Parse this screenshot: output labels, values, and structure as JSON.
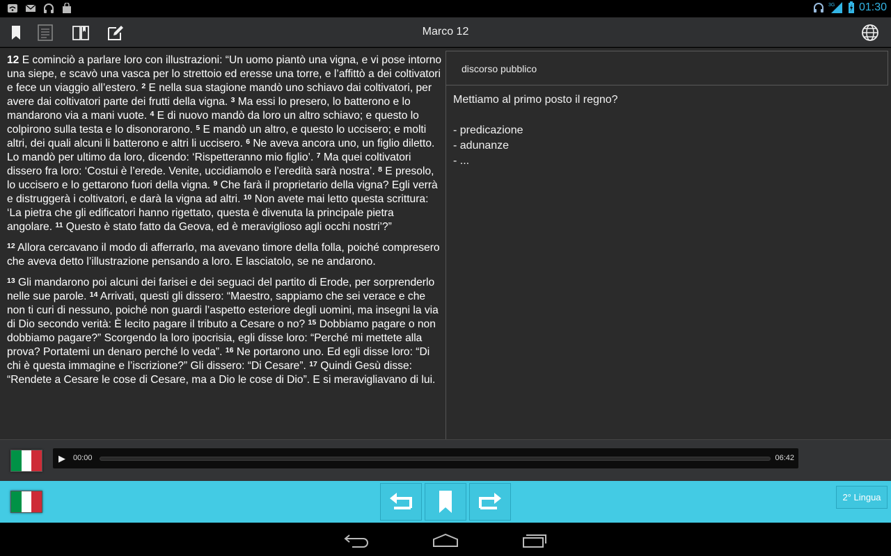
{
  "status_bar": {
    "time": "01:30",
    "left_icons": [
      "wifi-icon",
      "mail-icon",
      "headphones-icon",
      "shopping-bag-icon"
    ],
    "right_icons": [
      "headphones-icon",
      "signal-3g-icon",
      "battery-charging-icon"
    ],
    "network_label": "3G"
  },
  "action_bar": {
    "title": "Marco 12",
    "left_icons": [
      "bookmark-icon",
      "list-icon",
      "book-icon",
      "edit-note-icon"
    ],
    "right_icon": "globe-icon"
  },
  "bible": {
    "paragraphs": [
      [
        {
          "t": "chap",
          "v": "12"
        },
        {
          "t": "txt",
          "v": " E cominciò a parlare loro con illustrazioni: “Un uomo piantò una vigna, e vi pose intorno una siepe, e scavò una vasca per lo strettoio ed eresse una torre, e l’affittò a dei coltivatori e fece un viaggio all’estero. "
        },
        {
          "t": "sup",
          "v": "2"
        },
        {
          "t": "txt",
          "v": " E nella sua stagione mandò uno schiavo dai coltivatori, per avere dai coltivatori parte dei frutti della vigna. "
        },
        {
          "t": "sup",
          "v": "3"
        },
        {
          "t": "txt",
          "v": " Ma essi lo presero, lo batterono e lo mandarono via a mani vuote. "
        },
        {
          "t": "sup",
          "v": "4"
        },
        {
          "t": "txt",
          "v": " E di nuovo mandò da loro un altro schiavo; e questo lo colpirono sulla testa e lo disonorarono. "
        },
        {
          "t": "sup",
          "v": "5"
        },
        {
          "t": "txt",
          "v": " E mandò un altro, e questo lo uccisero; e molti altri, dei quali alcuni li batterono e altri li uccisero. "
        },
        {
          "t": "sup",
          "v": "6"
        },
        {
          "t": "txt",
          "v": " Ne aveva ancora uno, un figlio diletto. Lo mandò per ultimo da loro, dicendo: ‘Rispetteranno mio figlio’. "
        },
        {
          "t": "sup",
          "v": "7"
        },
        {
          "t": "txt",
          "v": " Ma quei coltivatori dissero fra loro: ‘Costui è l’erede. Venite, uccidiamolo e l’eredità sarà nostra’. "
        },
        {
          "t": "sup",
          "v": "8"
        },
        {
          "t": "txt",
          "v": " E presolo, lo uccisero e lo gettarono fuori della vigna. "
        },
        {
          "t": "sup",
          "v": "9"
        },
        {
          "t": "txt",
          "v": " Che farà il proprietario della vigna? Egli verrà e distruggerà i coltivatori, e darà la vigna ad altri. "
        },
        {
          "t": "sup",
          "v": "10"
        },
        {
          "t": "txt",
          "v": " Non avete mai letto questa scrittura: ‘La pietra che gli edificatori hanno rigettato, questa è divenuta la principale pietra angolare. "
        },
        {
          "t": "sup",
          "v": "11"
        },
        {
          "t": "txt",
          "v": " Questo è stato fatto da Geova, ed è meraviglioso agli occhi nostri’?”"
        }
      ],
      [
        {
          "t": "sup",
          "v": "12"
        },
        {
          "t": "txt",
          "v": " Allora cercavano il modo di afferrarlo, ma avevano timore della folla, poiché compresero che aveva detto l’illustrazione pensando a loro. E lasciatolo, se ne andarono."
        }
      ],
      [
        {
          "t": "sup",
          "v": "13"
        },
        {
          "t": "txt",
          "v": " Gli mandarono poi alcuni dei farisei e dei seguaci del partito di Erode, per sorprenderlo nelle sue parole. "
        },
        {
          "t": "sup",
          "v": "14"
        },
        {
          "t": "txt",
          "v": " Arrivati, questi gli dissero: “Maestro, sappiamo che sei verace e che non ti curi di nessuno, poiché non guardi l’aspetto esteriore degli uomini, ma insegni la via di Dio secondo verità: È lecito pagare il tributo a Cesare o no? "
        },
        {
          "t": "sup",
          "v": "15"
        },
        {
          "t": "txt",
          "v": " Dobbiamo pagare o non dobbiamo pagare?” Scorgendo la loro ipocrisia, egli disse loro: “Perché mi mettete alla prova? Portatemi un denaro perché lo veda”. "
        },
        {
          "t": "sup",
          "v": "16"
        },
        {
          "t": "txt",
          "v": " Ne portarono uno. Ed egli disse loro: “Di chi è questa immagine e l’iscrizione?” Gli dissero: “Di Cesare”. "
        },
        {
          "t": "sup",
          "v": "17"
        },
        {
          "t": "txt",
          "v": " Quindi Gesù disse: “Rendete a Cesare le cose di Cesare, ma a Dio le cose di Dio”. E si meravigliavano di lui."
        }
      ]
    ]
  },
  "notes": {
    "title": "discorso pubblico",
    "lines": [
      "Mettiamo al primo posto il regno?",
      "",
      "- predicazione",
      "- adunanze",
      "- ..."
    ]
  },
  "audio": {
    "current_time": "00:00",
    "total_time": "06:42",
    "progress": 0,
    "play_symbol": "▶"
  },
  "lang_bar": {
    "second_language_label": "2° Lingua",
    "buttons": [
      "back-arrow-icon",
      "bookmark-icon",
      "forward-arrow-icon"
    ]
  },
  "flag_colors": [
    "#009246",
    "#ffffff",
    "#ce2b37"
  ],
  "accent_color": "#43cbe4",
  "clock_color": "#33b5e5"
}
